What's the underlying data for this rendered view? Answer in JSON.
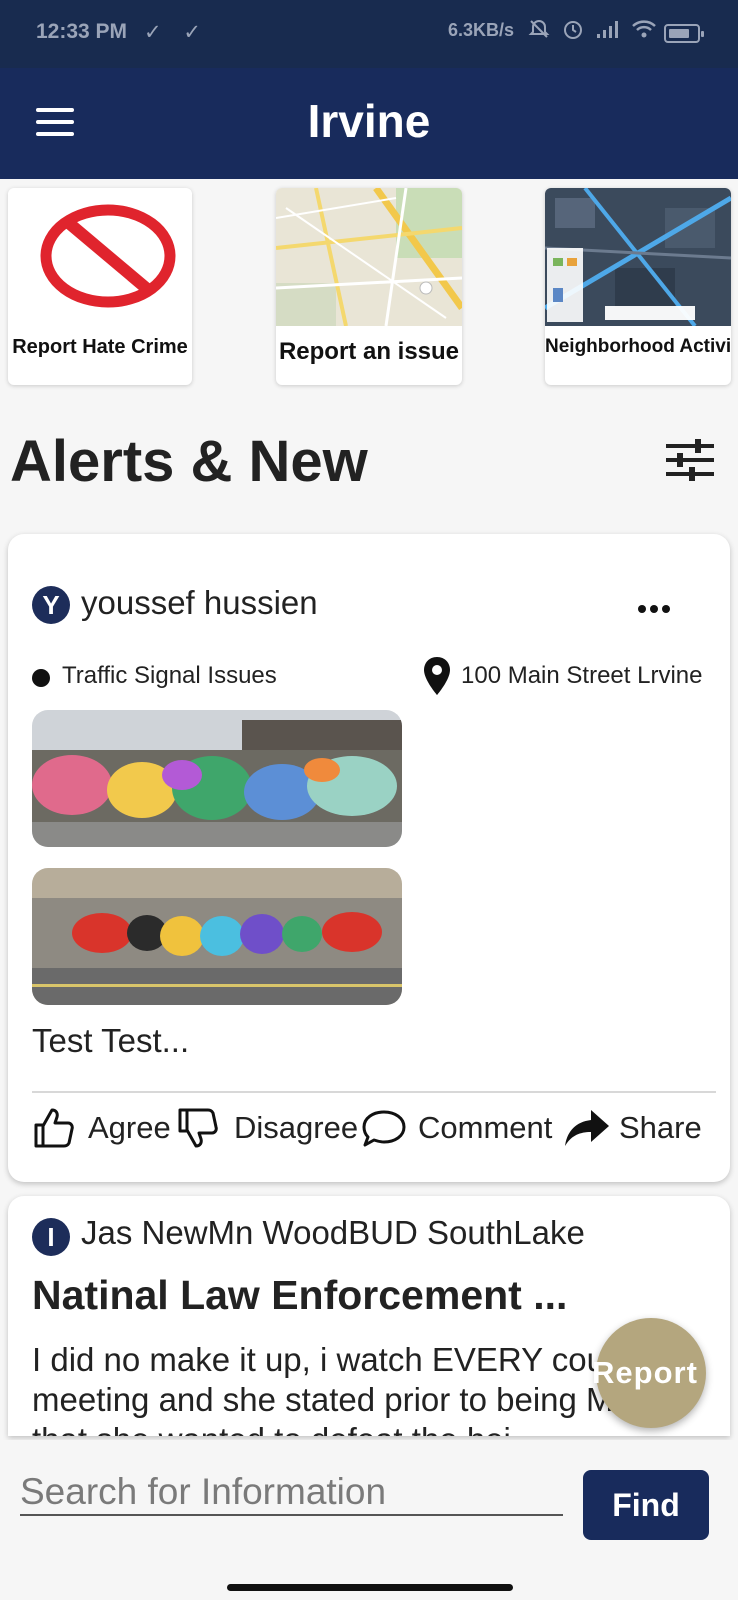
{
  "status_bar": {
    "time": "12:33 PM",
    "left_icons": "✓ ✓",
    "net_rate": "6.3KB/s",
    "right_icons": [
      "mute-icon",
      "alarm-icon",
      "signal-icon",
      "wifi-icon",
      "battery-icon"
    ]
  },
  "app_bar": {
    "title": "Irvine"
  },
  "quick_actions": [
    {
      "label": "Report Hate Crime",
      "icon": "no-entry-icon"
    },
    {
      "label": "Report an issue"
    },
    {
      "label": "Neighborhood Activity"
    }
  ],
  "section": {
    "title": "Alerts & New"
  },
  "posts": [
    {
      "avatar_letter": "Y",
      "author": "youssef hussien",
      "category": "Traffic Signal Issues",
      "location": "100 Main Street Lrvine",
      "body": "Test Test...",
      "actions": {
        "agree": "Agree",
        "disagree": "Disagree",
        "comment": "Comment",
        "share": "Share"
      }
    },
    {
      "avatar_letter": "I",
      "author": "Jas NewMn WoodBUD SouthLake",
      "headline": "Natinal Law Enforcement ...",
      "excerpt": "I did no make it up, i watch EVERY council meeting and she stated prior to being Mayor that she wanted to defeat the hei"
    }
  ],
  "fab": {
    "label": "Report"
  },
  "search": {
    "placeholder": "Search for Information",
    "value": "",
    "button": "Find"
  },
  "colors": {
    "primary": "#182b5c",
    "status_bar": "#182b4f",
    "fab": "#b4a67e",
    "no_entry": "#e0242d"
  }
}
